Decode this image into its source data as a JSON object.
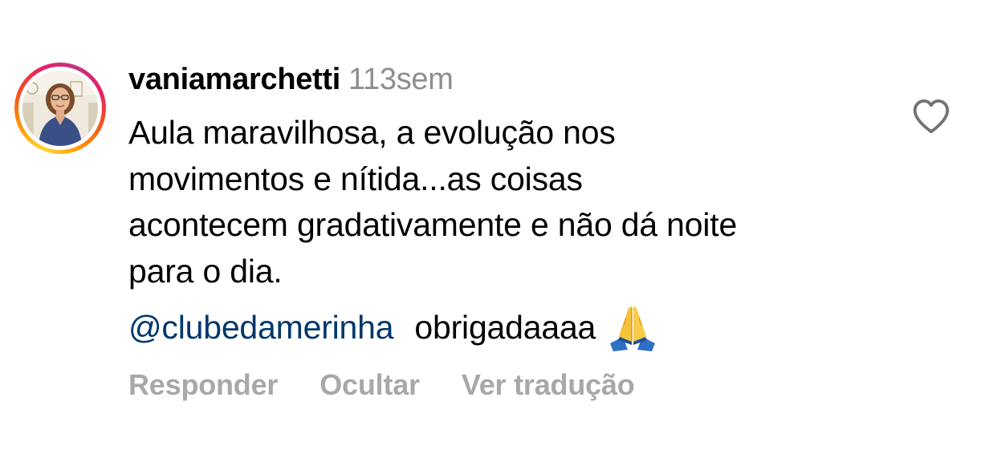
{
  "comment": {
    "username": "vaniamarchetti",
    "time": "113sem",
    "body_lines": [
      "Aula maravilhosa, a evolução nos",
      "movimentos e nítida...as coisas",
      "acontecem gradativamente e não dá noite",
      "para o dia."
    ],
    "mention": "@clubedamerinha",
    "reply_text": "obrigadaaaa",
    "emoji": "pray-emoji"
  },
  "actions": {
    "reply_label": "Responder",
    "hide_label": "Ocultar",
    "translate_label": "Ver tradução"
  },
  "icons": {
    "like": "heart-outline-icon"
  },
  "colors": {
    "mention": "#00376b",
    "secondary_text": "#8e8e8e",
    "action_text": "#a8a8a8",
    "primary_text": "#000000"
  }
}
